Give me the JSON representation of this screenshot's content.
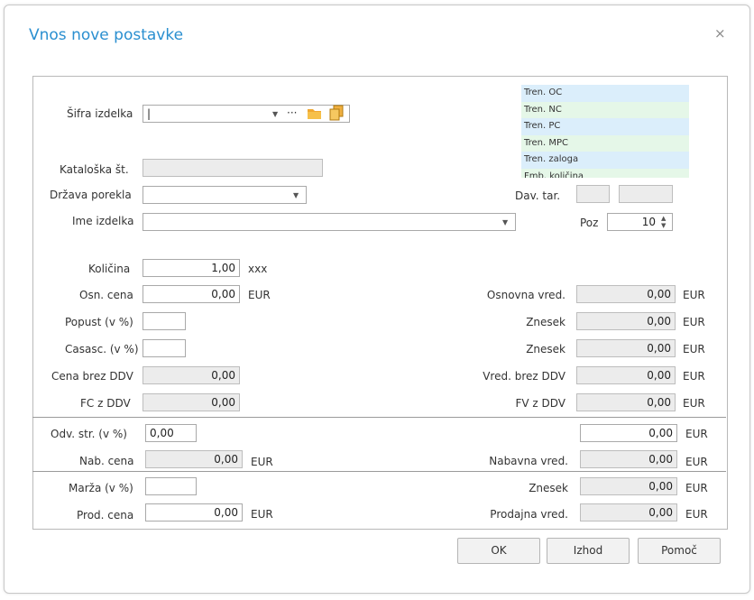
{
  "dialog": {
    "title": "Vnos nove postavke",
    "close": "×"
  },
  "header": {
    "sifra_label": "Šifra izdelka",
    "kataloska_label": "Kataloška št.",
    "drzava_label": "Država porekla",
    "ime_label": "Ime izdelka",
    "davtar_label": "Dav. tar.",
    "poz_label": "Poz",
    "poz_value": "10",
    "more": "···"
  },
  "info_list": [
    "Tren. OC",
    "Tren. NC",
    "Tren. PC",
    "Tren. MPC",
    "Tren. zaloga",
    "Fmb. količina"
  ],
  "left": {
    "kolicina_label": "Količina",
    "kolicina_value": "1,00",
    "kolicina_unit": "xxx",
    "osncena_label": "Osn. cena",
    "osncena_value": "0,00",
    "osncena_unit": "EUR",
    "popust_label": "Popust (v %)",
    "casasc_label": "Casasc. (v %)",
    "cenabrez_label": "Cena brez DDV",
    "cenabrez_value": "0,00",
    "fcddv_label": "FC z DDV",
    "fcddv_value": "0,00",
    "odv_label": "Odv. str. (v %)",
    "odv_value": "0,00",
    "nabcena_label": "Nab. cena",
    "nabcena_value": "0,00",
    "nabcena_unit": "EUR",
    "marza_label": "Marža (v %)",
    "prodcena_label": "Prod. cena",
    "prodcena_value": "0,00",
    "prodcena_unit": "EUR"
  },
  "right": {
    "osnvred_label": "Osnovna vred.",
    "osnvred_value": "0,00",
    "znesek1_label": "Znesek",
    "znesek1_value": "0,00",
    "znesek2_label": "Znesek",
    "znesek2_value": "0,00",
    "vredbrez_label": "Vred. brez DDV",
    "vredbrez_value": "0,00",
    "fvddv_label": "FV z DDV",
    "fvddv_value": "0,00",
    "odv_value": "0,00",
    "nabvred_label": "Nabavna vred.",
    "nabvred_value": "0,00",
    "znesek3_label": "Znesek",
    "znesek3_value": "0,00",
    "prodvred_label": "Prodajna vred.",
    "prodvred_value": "0,00",
    "unit": "EUR"
  },
  "buttons": {
    "ok": "OK",
    "izhod": "Izhod",
    "pomoc": "Pomoč"
  },
  "colors": {
    "title": "#2a8fd0",
    "list_blue": "#dbeefb",
    "list_green": "#e5f7e8",
    "folder": "#f0a830"
  }
}
